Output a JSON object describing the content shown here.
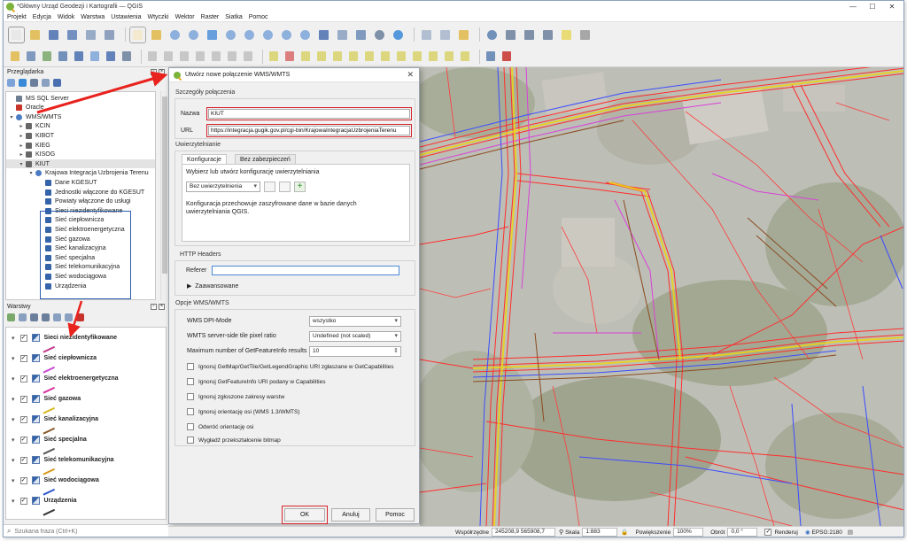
{
  "window": {
    "title": "*Główny Urząd Geodezji i Kartografii — QGIS",
    "controls": {
      "minimize": "—",
      "maximize": "☐",
      "close": "✕"
    }
  },
  "menu": [
    "Projekt",
    "Edycja",
    "Widok",
    "Warstwa",
    "Ustawienia",
    "Wtyczki",
    "Wektor",
    "Raster",
    "Siatka",
    "Pomoc"
  ],
  "browser_panel": {
    "title": "Przeglądarka",
    "items": [
      {
        "label": "MS SQL Server",
        "indent": 0,
        "arrow": "",
        "icon": "mssql-icon",
        "color": "#6e7d8f"
      },
      {
        "label": "Oracle",
        "indent": 0,
        "arrow": "",
        "icon": "oracle-icon",
        "color": "#c7352b"
      },
      {
        "label": "WMS/WMTS",
        "indent": 0,
        "arrow": "▾",
        "icon": "wms-globe-icon",
        "color": "#4b7cc4"
      },
      {
        "label": "KCIN",
        "indent": 1,
        "arrow": "▸",
        "icon": "connection-icon",
        "color": "#666"
      },
      {
        "label": "KIBOT",
        "indent": 1,
        "arrow": "▸",
        "icon": "connection-icon",
        "color": "#666"
      },
      {
        "label": "KIEG",
        "indent": 1,
        "arrow": "▸",
        "icon": "connection-icon",
        "color": "#666"
      },
      {
        "label": "KISOG",
        "indent": 1,
        "arrow": "▸",
        "icon": "connection-icon",
        "color": "#666"
      },
      {
        "label": "KIUT",
        "indent": 1,
        "arrow": "▾",
        "icon": "connection-icon",
        "color": "#666"
      },
      {
        "label": "Krajowa Integracja Uzbrojenia Terenu",
        "indent": 2,
        "arrow": "▾",
        "icon": "wms-globe-icon",
        "color": "#4b7cc4"
      },
      {
        "label": "Dane KGESUT",
        "indent": 3,
        "arrow": "",
        "icon": "wms-layer-icon",
        "color": "#3564a8"
      },
      {
        "label": "Jednostki włączone do KGESUT",
        "indent": 3,
        "arrow": "",
        "icon": "wms-layer-icon",
        "color": "#3564a8"
      },
      {
        "label": "Powiaty włączone do usługi",
        "indent": 3,
        "arrow": "",
        "icon": "wms-layer-icon",
        "color": "#3564a8"
      },
      {
        "label": "Sieci niezidentyfikowane",
        "indent": 3,
        "arrow": "",
        "icon": "wms-layer-icon",
        "color": "#3564a8"
      },
      {
        "label": "Sieć ciepłownicza",
        "indent": 3,
        "arrow": "",
        "icon": "wms-layer-icon",
        "color": "#3564a8"
      },
      {
        "label": "Sieć elektroenergetyczna",
        "indent": 3,
        "arrow": "",
        "icon": "wms-layer-icon",
        "color": "#3564a8"
      },
      {
        "label": "Sieć gazowa",
        "indent": 3,
        "arrow": "",
        "icon": "wms-layer-icon",
        "color": "#3564a8"
      },
      {
        "label": "Sieć kanalizacyjna",
        "indent": 3,
        "arrow": "",
        "icon": "wms-layer-icon",
        "color": "#3564a8"
      },
      {
        "label": "Sieć specjalna",
        "indent": 3,
        "arrow": "",
        "icon": "wms-layer-icon",
        "color": "#3564a8"
      },
      {
        "label": "Sieć telekomunikacyjna",
        "indent": 3,
        "arrow": "",
        "icon": "wms-layer-icon",
        "color": "#3564a8"
      },
      {
        "label": "Sieć wodociągowa",
        "indent": 3,
        "arrow": "",
        "icon": "wms-layer-icon",
        "color": "#3564a8"
      },
      {
        "label": "Urządzenia",
        "indent": 3,
        "arrow": "",
        "icon": "wms-layer-icon",
        "color": "#3564a8"
      }
    ]
  },
  "layers_panel": {
    "title": "Warstwy",
    "layers": [
      {
        "label": "Sieci niezidentyfikowane",
        "legend_color": "#c23a8a"
      },
      {
        "label": "Sieć ciepłownicza",
        "legend_color": "#c84bd2"
      },
      {
        "label": "Sieć elektroenergetyczna",
        "legend_color": "#d8319d"
      },
      {
        "label": "Sieć gazowa",
        "legend_color": "#d8b81f"
      },
      {
        "label": "Sieć kanalizacyjna",
        "legend_color": "#8b5a2b"
      },
      {
        "label": "Sieć specjalna",
        "legend_color": "#555555"
      },
      {
        "label": "Sieć telekomunikacyjna",
        "legend_color": "#d89a1f"
      },
      {
        "label": "Sieć wodociągowa",
        "legend_color": "#2f58d0"
      },
      {
        "label": "Urządzenia",
        "legend_color": "#333333"
      }
    ]
  },
  "search": {
    "placeholder": "Szukana fraza (Ctrl+K)"
  },
  "dialog": {
    "title": "Utwórz nowe połączenie WMS/WMTS",
    "connection_details_label": "Szczegóły połączenia",
    "name_label": "Nazwa",
    "name_value": "KIUT",
    "url_label": "URL",
    "url_value": "https://integracja.gugik.gov.pl/cgi-bin/KrajowaIntegracjaUzbrojeniaTerenu",
    "auth_label": "Uwierzytelnianie",
    "tabs": [
      "Konfiguracje",
      "Bez zabezpieczeń"
    ],
    "auth_select_text": "Wybierz lub utwórz konfigurację uwierzytelniania",
    "auth_combo": "Bez uwierzytelnienia",
    "auth_note": "Konfiguracja przechowuje zaszyfrowane dane w bazie danych uwierzytelniania QGIS.",
    "http_headers_label": "HTTP Headers",
    "referer_label": "Referer",
    "referer_value": "",
    "advanced_label": "Zaawansowane",
    "options_label": "Opcje WMS/WMTS",
    "dpi_label": "WMS DPI-Mode",
    "dpi_value": "wszystko",
    "tile_label": "WMTS server-side tile pixel ratio",
    "tile_value": "Undefined (not scaled)",
    "maxfeat_label": "Maximum number of GetFeatureInfo results",
    "maxfeat_value": "10",
    "checkboxes": [
      "Ignoruj GetMap/GetTile/GetLegendGraphic URI zgłaszane w GetCapabilities",
      "Ignoruj GetFeatureInfo URI podany w Capabilities",
      "Ignoruj zgłoszone zakresy warstw",
      "Ignoruj orientację osi (WMS 1.3/WMTS)",
      "Odwróć orientację osi",
      "Wygładź przekształcenie bitmap"
    ],
    "ok_label": "OK",
    "cancel_label": "Anuluj",
    "help_label": "Pomoc",
    "close": "✕"
  },
  "statusbar": {
    "coord_label": "Współrzędne",
    "coord_value": "245208,9  565908,7",
    "scale_label": "Skala",
    "scale_value": "1:883",
    "magnifier_label": "Powiększenie",
    "magnifier_value": "100%",
    "rotation_label": "Obrót",
    "rotation_value": "0,0 °",
    "render_label": "Renderuj",
    "crs_label": "EPSG:2180"
  },
  "colors": {
    "highlight_red": "#d6232c",
    "highlight_blue": "#2b5dad",
    "network_red": "#ff2d2d",
    "network_blue": "#3b4cff",
    "network_magenta": "#d940d9"
  }
}
